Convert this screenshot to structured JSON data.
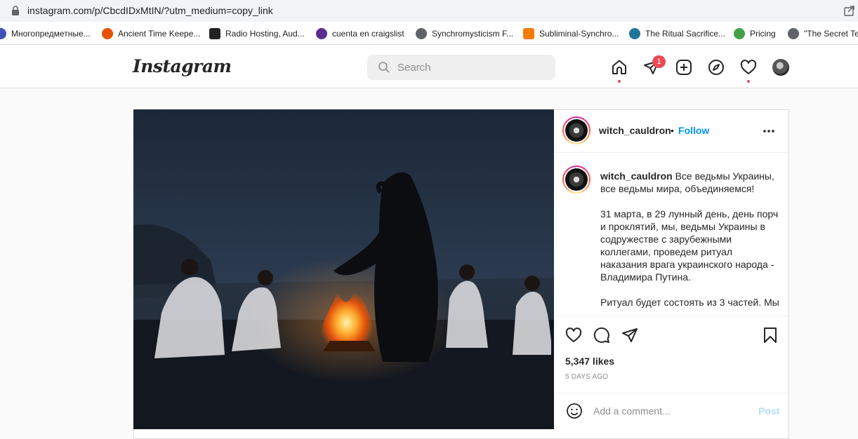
{
  "browser": {
    "url": "instagram.com/p/CbcdIDxMtIN/?utm_medium=copy_link",
    "bookmarks": [
      {
        "label": "Многопредметные...",
        "icon": "star-icon",
        "color": "#3f51b5"
      },
      {
        "label": "Ancient Time Keepe...",
        "icon": "pyramid-icon",
        "color": "#e65100"
      },
      {
        "label": "Radio Hosting, Aud...",
        "icon": "r-logo-icon",
        "color": "#222222"
      },
      {
        "label": "cuenta en craigslist",
        "icon": "peace-icon",
        "color": "#5c2d91"
      },
      {
        "label": "Synchromysticism F...",
        "icon": "globe-icon",
        "color": "#5f6368"
      },
      {
        "label": "Subliminal-Synchro...",
        "icon": "blogger-icon",
        "color": "#f57c00"
      },
      {
        "label": "The Ritual Sacrifice...",
        "icon": "wordpress-icon",
        "color": "#21759b"
      },
      {
        "label": "Pricing",
        "icon": "circle-icon",
        "color": "#43a047"
      },
      {
        "label": "\"The Secret Tea",
        "icon": "globe-icon",
        "color": "#5f6368"
      }
    ]
  },
  "header": {
    "logo": "Instagram",
    "search_placeholder": "Search",
    "notification_count": "1"
  },
  "post": {
    "username": "witch_cauldron",
    "follow_label": "Follow",
    "separator": "•",
    "caption_username": "witch_cauldron",
    "caption_p1": "Все ведьмы Украины, все ведьмы мира, объединяемся!",
    "caption_p2": "31 марта, в 29 лунный день, день порч и проклятий, мы, ведьмы Украины в содружестве с зарубежными коллегами, проведем ритуал наказания врага украинского народа - Владимира Путина.",
    "caption_p3": "Ритуал будет состоять из 3 частей. Мы",
    "likes": "5,347 likes",
    "time_ago": "5 DAYS AGO",
    "comment_placeholder": "Add a comment...",
    "post_label": "Post"
  }
}
